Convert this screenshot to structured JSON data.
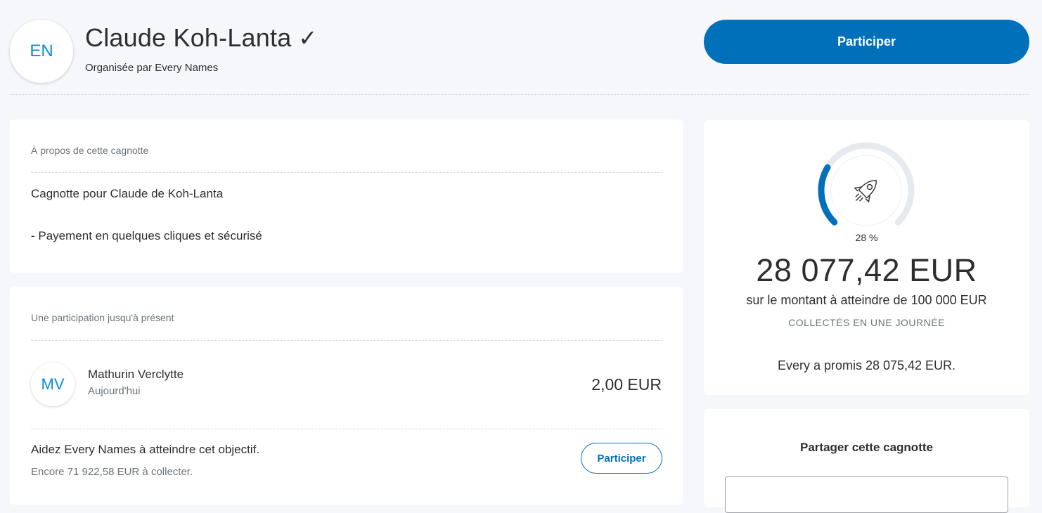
{
  "header": {
    "avatar_initials": "EN",
    "title": "Claude Koh-Lanta",
    "verified_mark": "✓",
    "organizer": "Organisée par Every Names",
    "participate_label": "Participer"
  },
  "about": {
    "heading": "À propos de cette cagnotte",
    "line1": "Cagnotte pour Claude de Koh-Lanta",
    "line2": "- Payement en quelques cliques et sécurisé"
  },
  "participations": {
    "heading": "Une participation jusqu'à présent",
    "items": [
      {
        "initials": "MV",
        "name": "Mathurin Verclytte",
        "date": "Aujourd'hui",
        "amount": "2,00 EUR"
      }
    ],
    "help_title": "Aidez Every Names à atteindre cet objectif.",
    "help_sub": "Encore 71 922,58 EUR à collecter.",
    "participate_label": "Participer"
  },
  "goal": {
    "progress_percent": 28,
    "percent_label": "28 %",
    "raised": "28 077,42 EUR",
    "goal_line": "sur le montant à atteindre de 100 000 EUR",
    "period": "COLLECTÉS EN UNE JOURNÉE",
    "promise": "Every a promis 28 075,42 EUR.",
    "icon": "rocket-icon"
  },
  "share": {
    "title": "Partager cette cagnotte"
  },
  "colors": {
    "primary": "#0070ba",
    "initials": "#0a8fd1",
    "background": "#f5f7fa",
    "progress_track": "#e6e9ed"
  }
}
